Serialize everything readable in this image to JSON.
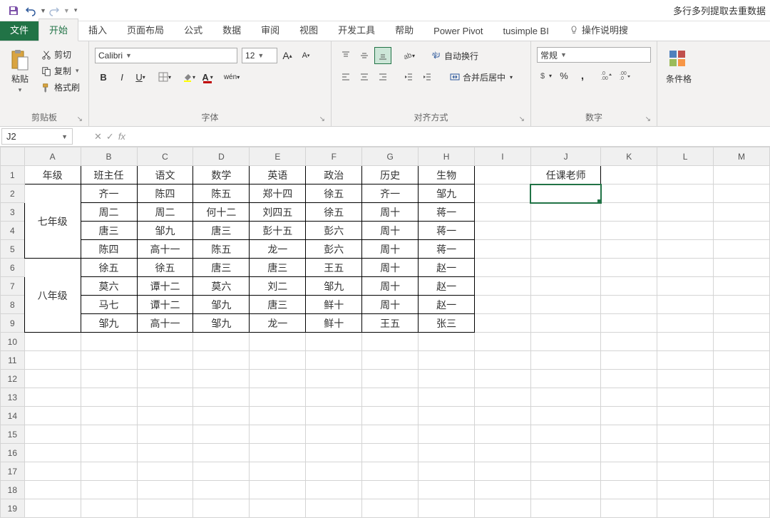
{
  "title": "多行多列提取去重数据",
  "qat": {
    "save": "save",
    "undo": "undo",
    "redo": "redo"
  },
  "tabs": {
    "file": "文件",
    "home": "开始",
    "insert": "插入",
    "pagelayout": "页面布局",
    "formulas": "公式",
    "data": "数据",
    "review": "审阅",
    "view": "视图",
    "developer": "开发工具",
    "help": "帮助",
    "powerpivot": "Power Pivot",
    "tusimple": "tusimple BI",
    "tell": "操作说明搜"
  },
  "ribbon": {
    "clipboard": {
      "label": "剪贴板",
      "paste": "粘贴",
      "cut": "剪切",
      "copy": "复制",
      "format_painter": "格式刷"
    },
    "font": {
      "label": "字体",
      "name": "Calibri",
      "size": "12",
      "bold": "B",
      "italic": "I",
      "underline": "U",
      "wen": "wén"
    },
    "alignment": {
      "label": "对齐方式",
      "wrap": "自动换行",
      "merge": "合并后居中"
    },
    "number": {
      "label": "数字",
      "format": "常规"
    },
    "styles": {
      "cond_format": "条件格"
    }
  },
  "formula_bar": {
    "namebox": "J2",
    "fx": "fx"
  },
  "columns": [
    "A",
    "B",
    "C",
    "D",
    "E",
    "F",
    "G",
    "H",
    "I",
    "J",
    "K",
    "L",
    "M"
  ],
  "rows_count": 19,
  "headers": [
    "年级",
    "班主任",
    "语文",
    "数学",
    "英语",
    "政治",
    "历史",
    "生物"
  ],
  "j1": "任课老师",
  "grade_labels": {
    "g7": "七年级",
    "g8": "八年级"
  },
  "data_rows": [
    [
      "齐一",
      "陈四",
      "陈五",
      "郑十四",
      "徐五",
      "齐一",
      "邹九"
    ],
    [
      "周二",
      "周二",
      "何十二",
      "刘四五",
      "徐五",
      "周十",
      "蒋一"
    ],
    [
      "唐三",
      "邹九",
      "唐三",
      "彭十五",
      "彭六",
      "周十",
      "蒋一"
    ],
    [
      "陈四",
      "高十一",
      "陈五",
      "龙一",
      "彭六",
      "周十",
      "蒋一"
    ],
    [
      "徐五",
      "徐五",
      "唐三",
      "唐三",
      "王五",
      "周十",
      "赵一"
    ],
    [
      "莫六",
      "谭十二",
      "莫六",
      "刘二",
      "邹九",
      "周十",
      "赵一"
    ],
    [
      "马七",
      "谭十二",
      "邹九",
      "唐三",
      "鲜十",
      "周十",
      "赵一"
    ],
    [
      "邹九",
      "高十一",
      "邹九",
      "龙一",
      "鲜十",
      "王五",
      "张三"
    ]
  ],
  "col_widths": {
    "rowhead": 34,
    "default": 80,
    "J": 100
  }
}
